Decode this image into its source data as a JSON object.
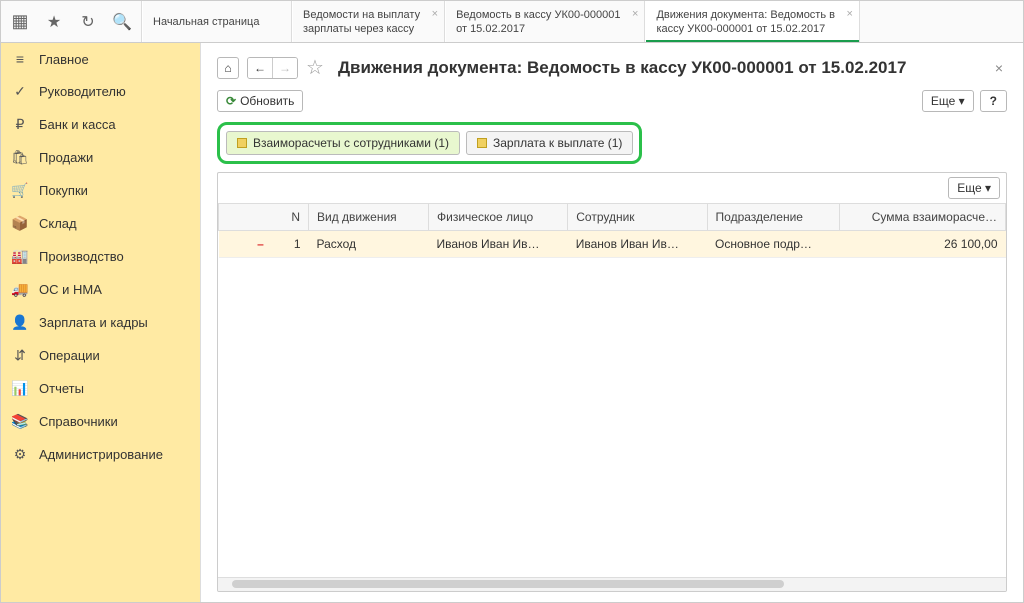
{
  "top_icons": {
    "apps": "apps",
    "star": "★",
    "history": "↻",
    "search": "🔍"
  },
  "tabs": [
    {
      "line1": "Начальная страница",
      "line2": "",
      "closable": false
    },
    {
      "line1": "Ведомости на выплату",
      "line2": "зарплаты через кассу",
      "closable": true
    },
    {
      "line1": "Ведомость в кассу УК00-000001",
      "line2": "от 15.02.2017",
      "closable": true
    },
    {
      "line1": "Движения документа: Ведомость в",
      "line2": "кассу УК00-000001 от 15.02.2017",
      "closable": true,
      "active": true
    }
  ],
  "sidebar": [
    {
      "icon": "≡",
      "label": "Главное"
    },
    {
      "icon": "✓",
      "label": "Руководителю"
    },
    {
      "icon": "₽",
      "label": "Банк и касса"
    },
    {
      "icon": "🛍",
      "label": "Продажи"
    },
    {
      "icon": "🛒",
      "label": "Покупки"
    },
    {
      "icon": "📦",
      "label": "Склад"
    },
    {
      "icon": "🏭",
      "label": "Производство"
    },
    {
      "icon": "🚚",
      "label": "ОС и НМА"
    },
    {
      "icon": "👤",
      "label": "Зарплата и кадры"
    },
    {
      "icon": "⇵",
      "label": "Операции"
    },
    {
      "icon": "📊",
      "label": "Отчеты"
    },
    {
      "icon": "📚",
      "label": "Справочники"
    },
    {
      "icon": "⚙",
      "label": "Администрирование"
    }
  ],
  "header": {
    "home": "⌂",
    "back": "←",
    "forward": "→",
    "star": "☆",
    "title": "Движения документа: Ведомость в кассу УК00-000001 от 15.02.2017",
    "close": "×"
  },
  "toolbar": {
    "refresh_label": "Обновить",
    "more_label": "Еще ▾",
    "help_label": "?"
  },
  "subtabs": [
    {
      "label": "Взаиморасчеты с сотрудниками (1)",
      "active": true
    },
    {
      "label": "Зарплата к выплате (1)",
      "active": false
    }
  ],
  "table": {
    "more_label": "Еще ▾",
    "columns": [
      "N",
      "Вид движения",
      "Физическое лицо",
      "Сотрудник",
      "Подразделение",
      "Сумма взаиморасче…"
    ],
    "rows": [
      {
        "n": "1",
        "type": "Расход",
        "person": "Иванов Иван Ив…",
        "employee": "Иванов Иван Ив…",
        "dept": "Основное подр…",
        "sum": "26 100,00"
      }
    ]
  }
}
